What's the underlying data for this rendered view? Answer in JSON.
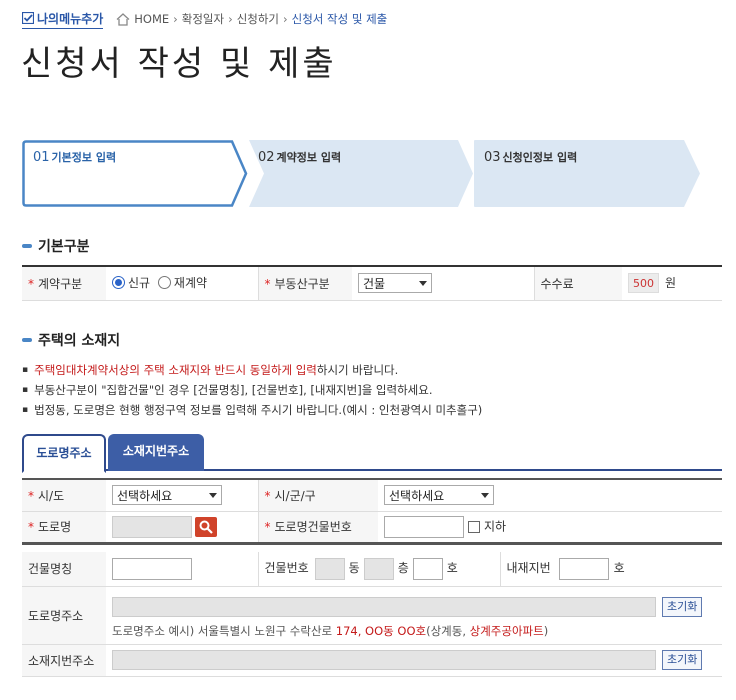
{
  "topbar": {
    "fav_label": "나의메뉴추가",
    "breadcrumb": [
      "HOME",
      "확정일자",
      "신청하기",
      "신청서 작성 및 제출"
    ]
  },
  "page_title": "신청서 작성 및 제출",
  "steps": [
    {
      "num": "01",
      "label": "기본정보 입력",
      "active": true
    },
    {
      "num": "02",
      "label": "계약정보 입력",
      "active": false
    },
    {
      "num": "03",
      "label": "신청인정보 입력",
      "active": false
    }
  ],
  "basic": {
    "heading": "기본구분",
    "contract_type_label": "계약구분",
    "contract_options": [
      "신규",
      "재계약"
    ],
    "contract_selected": "신규",
    "property_type_label": "부동산구분",
    "property_value": "건물",
    "fee_label": "수수료",
    "fee_value": "500",
    "fee_unit": "원"
  },
  "location": {
    "heading": "주택의 소재지",
    "notes": [
      {
        "red": "주택임대차계약서상의 주택 소재지와 반드시 동일하게 입력",
        "normal": "하시기 바랍니다."
      },
      {
        "red": "",
        "normal": "부동산구분이 \"집합건물\"인 경우 [건물명칭], [건물번호], [내재지번]을 입력하세요."
      },
      {
        "red": "",
        "normal": "법정동, 도로명은 현행 행정구역 정보를 입력해 주시기 바랍니다.(예시 : 인천광역시 미추홀구)"
      }
    ],
    "tabs": [
      "도로명주소",
      "소재지번주소"
    ],
    "sido_label": "시/도",
    "sido_value": "선택하세요",
    "sigungu_label": "시/군/구",
    "sigungu_value": "선택하세요",
    "road_label": "도로명",
    "bldg_no_label": "도로명건물번호",
    "basement_label": "지하",
    "bldg_name_label": "건물명칭",
    "bldg_num_label": "건물번호",
    "dong_unit": "동",
    "floor_unit": "층",
    "ho_unit": "호",
    "inner_lot_label": "내재지번",
    "inner_ho_unit": "호",
    "road_addr_label": "도로명주소",
    "reset_label": "초기화",
    "example_prefix": "도로명주소 예시) 서울특별시 노원구 수락산로 ",
    "example_red1": "174, OO동 OO호",
    "example_mid": "(상계동, ",
    "example_red2": "상계주공아파트",
    "example_suffix": ")",
    "lot_addr_label": "소재지번주소",
    "reset_label2": "초기화"
  },
  "colors": {
    "accent": "#2f4a8c",
    "required": "#dd2222",
    "step_active": "#4a86c6",
    "step_inactive": "#dbe7f3"
  }
}
